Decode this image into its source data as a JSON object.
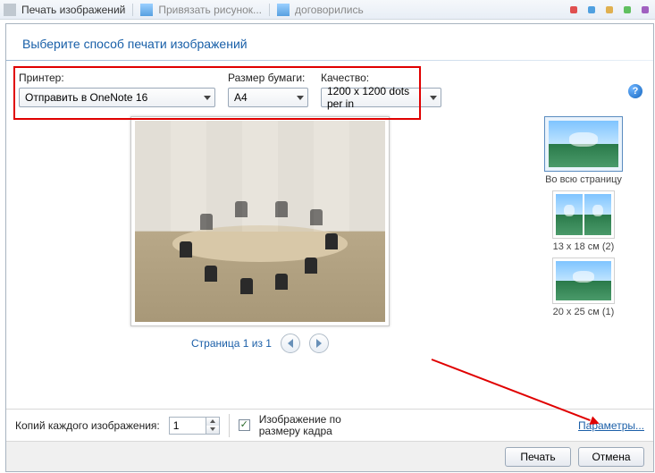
{
  "titlebar": {
    "title": "Печать изображений",
    "tab1": "Привязать рисунок...",
    "tab2": "договорились"
  },
  "heading": "Выберите способ печати изображений",
  "labels": {
    "printer": "Принтер:",
    "paper": "Размер бумаги:",
    "quality": "Качество:"
  },
  "combos": {
    "printer": "Отправить в OneNote 16",
    "paper": "A4",
    "quality": "1200 x 1200 dots per in"
  },
  "pager": {
    "text": "Страница 1 из 1"
  },
  "layouts": {
    "full": "Во всю страницу",
    "l13x18": "13 x 18 см (2)",
    "l20x25": "20 x 25 см (1)"
  },
  "bottom": {
    "copies_label": "Копий каждого изображения:",
    "copies_value": "1",
    "fit_label": "Изображение по\nразмеру кадра",
    "options_link": "Параметры..."
  },
  "footer": {
    "print": "Печать",
    "cancel": "Отмена"
  },
  "checkmark": "✓"
}
